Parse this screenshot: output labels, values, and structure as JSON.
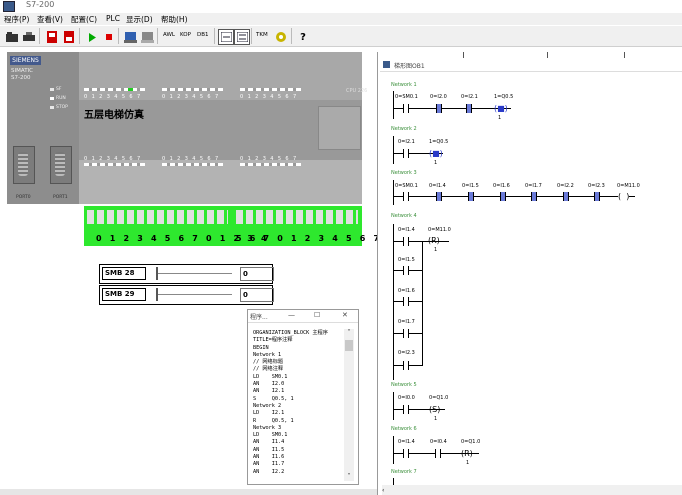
{
  "window": {
    "title": "S7-200"
  },
  "menu": [
    "程序(P)",
    "查看(V)",
    "配置(C)",
    "PLC",
    "显示(D)",
    "帮助(H)"
  ],
  "toolbar": {
    "awl": "AWL",
    "kop": "KOP",
    "dbi": "DB1",
    "tkm": "TKM"
  },
  "plc": {
    "brand": "SIEMENS",
    "model": "SIMATIC S7-200",
    "model_lines": [
      "SIMATIC",
      "S7-200"
    ],
    "status_leds": [
      "SF",
      "RUN",
      "STOP"
    ],
    "cpu": "CPU 226",
    "title_plate": "五层电梯仿真",
    "port0": "PORT0",
    "port1": "PORT1",
    "io_digits": "0 1 2 3 4 5 6 7",
    "terminal_left": "0 1 2 3 4 5 6 7 0 1 2 3 4",
    "terminal_right": "5 6 7 0 1 2 3 4 5 6 7"
  },
  "smb": [
    {
      "label": "SMB 28",
      "value": "0"
    },
    {
      "label": "SMB 29",
      "value": "0"
    }
  ],
  "code_window": {
    "title": "程序...",
    "lines": [
      "ORGANIZATION_BLOCK 主程序",
      "TITLE=程序注释",
      "BEGIN",
      "Network 1",
      "// 网络标题",
      "// 网络注释",
      "LD    SM0.1",
      "AN    I2.0",
      "AN    I2.1",
      "S     Q0.5, 1",
      "Network 2",
      "LD    I2.1",
      "R     Q0.5, 1",
      "Network 3",
      "LD    SM0.1",
      "AN    I1.4",
      "AN    I1.5",
      "AN    I1.6",
      "AN    I1.7",
      "AN    I2.2"
    ]
  },
  "ladder": {
    "window_title": "梯形图OB1",
    "networks": [
      {
        "label": "Network 1",
        "operands": [
          "0=SM0.1",
          "0=I2.0",
          "0=I2.1",
          "1=Q0.5"
        ],
        "coil": "S",
        "param": "1"
      },
      {
        "label": "Network 2",
        "operands": [
          "0=I2.1",
          "1=Q0.5"
        ],
        "coil": "R",
        "param": "1"
      },
      {
        "label": "Network 3",
        "operands": [
          "0=SM0.1",
          "0=I1.4",
          "0=I1.5",
          "0=I1.6",
          "0=I1.7",
          "0=I2.2",
          "0=I2.3",
          "0=M11.0"
        ]
      },
      {
        "label": "Network 4",
        "operands": [
          "0=I1.4",
          "0=M11.0",
          "0=I1.5",
          "0=I1.6",
          "0=I1.7",
          "0=I2.3"
        ],
        "coil": "R",
        "param": "1"
      },
      {
        "label": "Network 5",
        "operands": [
          "0=I0.0",
          "0=Q1.0"
        ],
        "coil": "S",
        "param": "1"
      },
      {
        "label": "Network 6",
        "operands": [
          "0=I1.4",
          "0=I0.4",
          "0=Q1.0"
        ],
        "coil": "R",
        "param": "1"
      },
      {
        "label": "Network 7"
      }
    ]
  },
  "colors": {
    "terminal": "#2ee82e",
    "energized": "#6a7ad8",
    "plc_body": "#b3b3b3",
    "network_label": "#3a8f3a"
  }
}
